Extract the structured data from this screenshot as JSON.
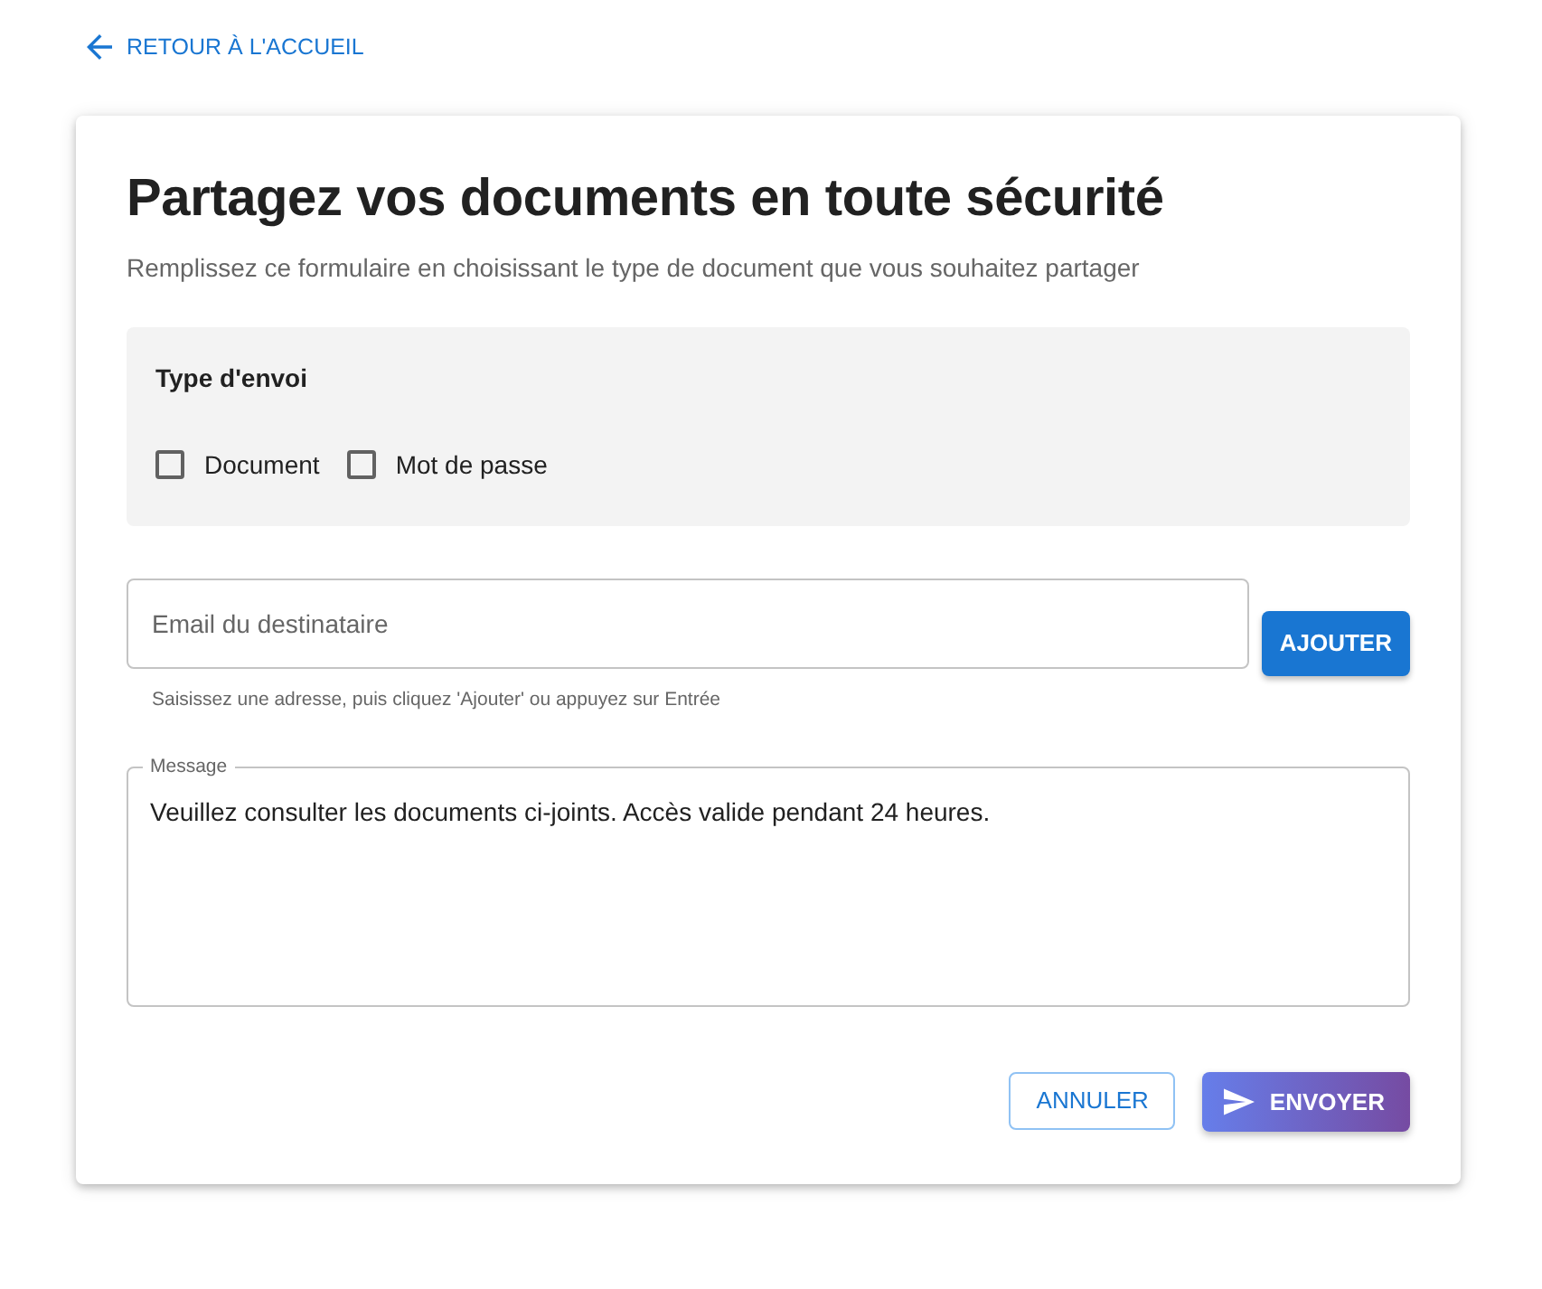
{
  "back_link": {
    "label": "RETOUR À L'ACCUEIL"
  },
  "form": {
    "title": "Partagez vos documents en toute sécurité",
    "subtitle": "Remplissez ce formulaire en choisissant le type de document que vous souhaitez partager",
    "send_type": {
      "label": "Type d'envoi",
      "options": [
        {
          "label": "Document",
          "checked": false
        },
        {
          "label": "Mot de passe",
          "checked": false
        }
      ]
    },
    "recipient": {
      "placeholder": "Email du destinataire",
      "helper": "Saisissez une adresse, puis cliquez 'Ajouter' ou appuyez sur Entrée",
      "add_button": "AJOUTER"
    },
    "message": {
      "label": "Message",
      "value": "Veuillez consulter les documents ci-joints. Accès valide pendant 24 heures."
    },
    "buttons": [
      {
        "label": "ANNULER",
        "kind": "outline"
      },
      {
        "label": "ENVOYER",
        "kind": "send"
      }
    ]
  }
}
